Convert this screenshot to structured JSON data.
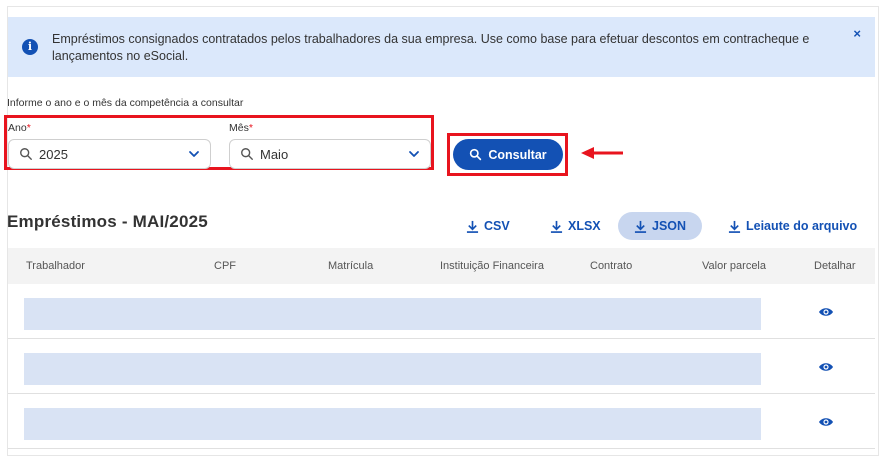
{
  "alert": {
    "text": "Empréstimos consignados contratados pelos trabalhadores da sua empresa. Use como base para efetuar descontos em contracheque e lançamentos no eSocial.",
    "icon": "info-icon",
    "close_label": "×"
  },
  "form": {
    "hint": "Informe o ano e o mês da competência a consultar",
    "year_label": "Ano",
    "year_value": "2025",
    "month_label": "Mês",
    "month_value": "Maio",
    "required_mark": "*",
    "submit_label": "Consultar"
  },
  "section": {
    "title": "Empréstimos - MAI/2025"
  },
  "downloads": [
    {
      "label": "CSV"
    },
    {
      "label": "XLSX"
    },
    {
      "label": "JSON"
    },
    {
      "label": "Leiaute do arquivo"
    }
  ],
  "table": {
    "columns": [
      "Trabalhador",
      "CPF",
      "Matrícula",
      "Instituição Financeira",
      "Contrato",
      "Valor parcela",
      "Detalhar"
    ]
  },
  "colors": {
    "primary": "#1351b4",
    "alert_bg": "#dbe8fb",
    "highlight": "#e8141e",
    "placeholder_bar": "#d9e3f4"
  }
}
